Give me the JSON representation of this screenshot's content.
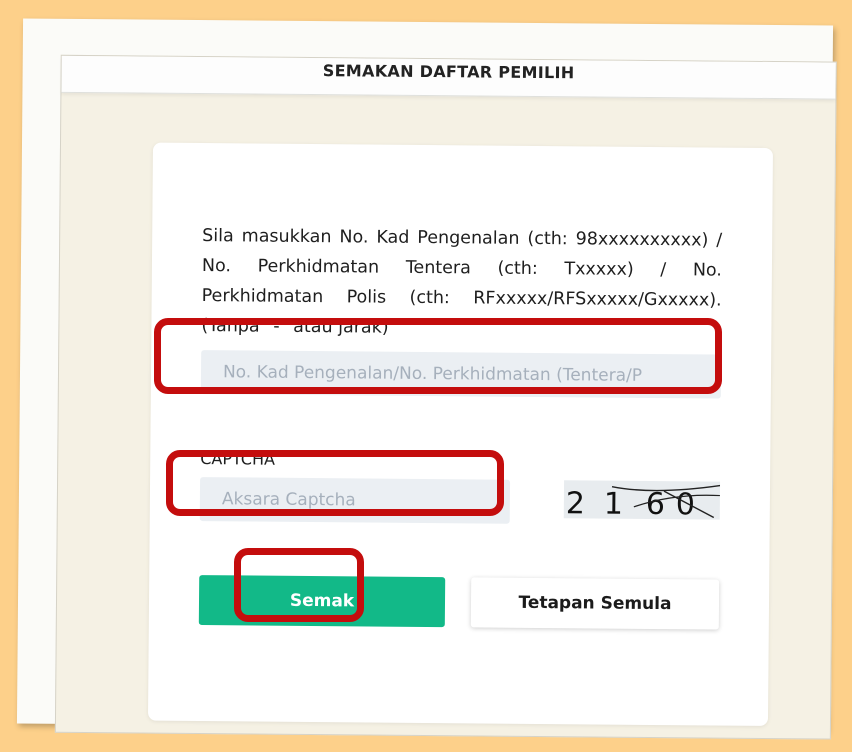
{
  "header": {
    "title": "SEMAKAN DAFTAR PEMILIH"
  },
  "form": {
    "instructions": "Sila masukkan No. Kad Pengenalan (cth: 98xxxxxxxxxx) / No. Perkhidmatan Tentera (cth: Txxxxx) / No. Perkhidmatan Polis (cth: RFxxxxx/RFSxxxxx/Gxxxxx). (Tanpa \"-\" atau jarak)",
    "id_input": {
      "placeholder": "No. Kad Pengenalan/No. Perkhidmatan (Tentera/P",
      "value": ""
    },
    "captcha_label": "CAPTCHA",
    "captcha_input": {
      "placeholder": "Aksara Captcha",
      "value": ""
    },
    "captcha_text": "2160",
    "check_button": "Semak",
    "reset_button": "Tetapan Semula"
  },
  "colors": {
    "background": "#fdd08a",
    "primary_button": "#12b988",
    "highlight": "#c40d0d",
    "input_bg": "#ebeff3"
  }
}
